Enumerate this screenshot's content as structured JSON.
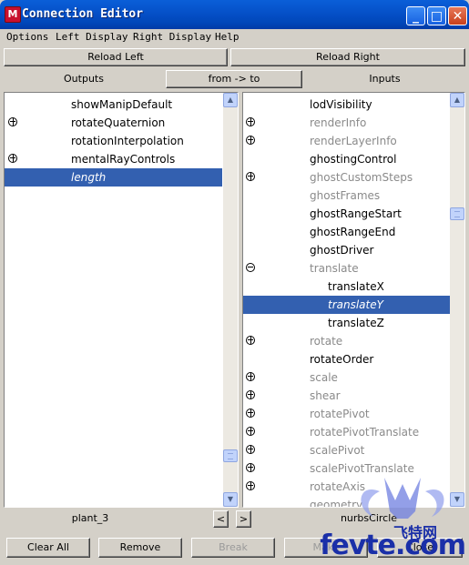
{
  "window": {
    "title": "Connection Editor",
    "icon": "maya-app-icon",
    "controls": [
      "minimize-icon",
      "maximize-icon",
      "close-icon"
    ]
  },
  "menu": {
    "options": "Options",
    "left_display": "Left Display",
    "right_display": "Right Display",
    "help": "Help"
  },
  "toolbar": {
    "reload_left": "Reload Left",
    "reload_right": "Reload Right"
  },
  "headers": {
    "outputs": "Outputs",
    "direction": "from -> to",
    "inputs": "Inputs"
  },
  "left_list": [
    {
      "label": "showManipDefault",
      "expander": null,
      "state": "normal"
    },
    {
      "label": "rotateQuaternion",
      "expander": "plus",
      "state": "normal"
    },
    {
      "label": "rotationInterpolation",
      "expander": null,
      "state": "normal"
    },
    {
      "label": "mentalRayControls",
      "expander": "plus",
      "state": "normal"
    },
    {
      "label": "length",
      "expander": null,
      "state": "selected"
    }
  ],
  "right_list": [
    {
      "label": "lodVisibility",
      "expander": null,
      "state": "normal",
      "indent": 0
    },
    {
      "label": "renderInfo",
      "expander": "plus",
      "state": "dim",
      "indent": 0
    },
    {
      "label": "renderLayerInfo",
      "expander": "plus",
      "state": "dim",
      "indent": 0
    },
    {
      "label": "ghostingControl",
      "expander": null,
      "state": "normal",
      "indent": 0
    },
    {
      "label": "ghostCustomSteps",
      "expander": "plus",
      "state": "dim",
      "indent": 0
    },
    {
      "label": "ghostFrames",
      "expander": null,
      "state": "dim",
      "indent": 0
    },
    {
      "label": "ghostRangeStart",
      "expander": null,
      "state": "normal",
      "indent": 0
    },
    {
      "label": "ghostRangeEnd",
      "expander": null,
      "state": "normal",
      "indent": 0
    },
    {
      "label": "ghostDriver",
      "expander": null,
      "state": "normal",
      "indent": 0
    },
    {
      "label": "translate",
      "expander": "minus",
      "state": "dim",
      "indent": 0
    },
    {
      "label": "translateX",
      "expander": null,
      "state": "normal",
      "indent": 1
    },
    {
      "label": "translateY",
      "expander": null,
      "state": "selected",
      "indent": 1
    },
    {
      "label": "translateZ",
      "expander": null,
      "state": "normal",
      "indent": 1
    },
    {
      "label": "rotate",
      "expander": "plus",
      "state": "dim",
      "indent": 0
    },
    {
      "label": "rotateOrder",
      "expander": null,
      "state": "normal",
      "indent": 0
    },
    {
      "label": "scale",
      "expander": "plus",
      "state": "dim",
      "indent": 0
    },
    {
      "label": "shear",
      "expander": "plus",
      "state": "dim",
      "indent": 0
    },
    {
      "label": "rotatePivot",
      "expander": "plus",
      "state": "dim",
      "indent": 0
    },
    {
      "label": "rotatePivotTranslate",
      "expander": "plus",
      "state": "dim",
      "indent": 0
    },
    {
      "label": "scalePivot",
      "expander": "plus",
      "state": "dim",
      "indent": 0
    },
    {
      "label": "scalePivotTranslate",
      "expander": "plus",
      "state": "dim",
      "indent": 0
    },
    {
      "label": "rotateAxis",
      "expander": "plus",
      "state": "dim",
      "indent": 0
    },
    {
      "label": "geometry",
      "expander": null,
      "state": "dim",
      "indent": 0
    }
  ],
  "nodes": {
    "left": "plant_3",
    "right": "nurbsCircle",
    "prev_label": "<",
    "next_label": ">"
  },
  "bottom_buttons": {
    "clear_all": "Clear All",
    "remove": "Remove",
    "break": "Break",
    "make": "Make",
    "close": "Close"
  },
  "watermark": {
    "cn": "飞特网",
    "text": "fevte.com"
  }
}
